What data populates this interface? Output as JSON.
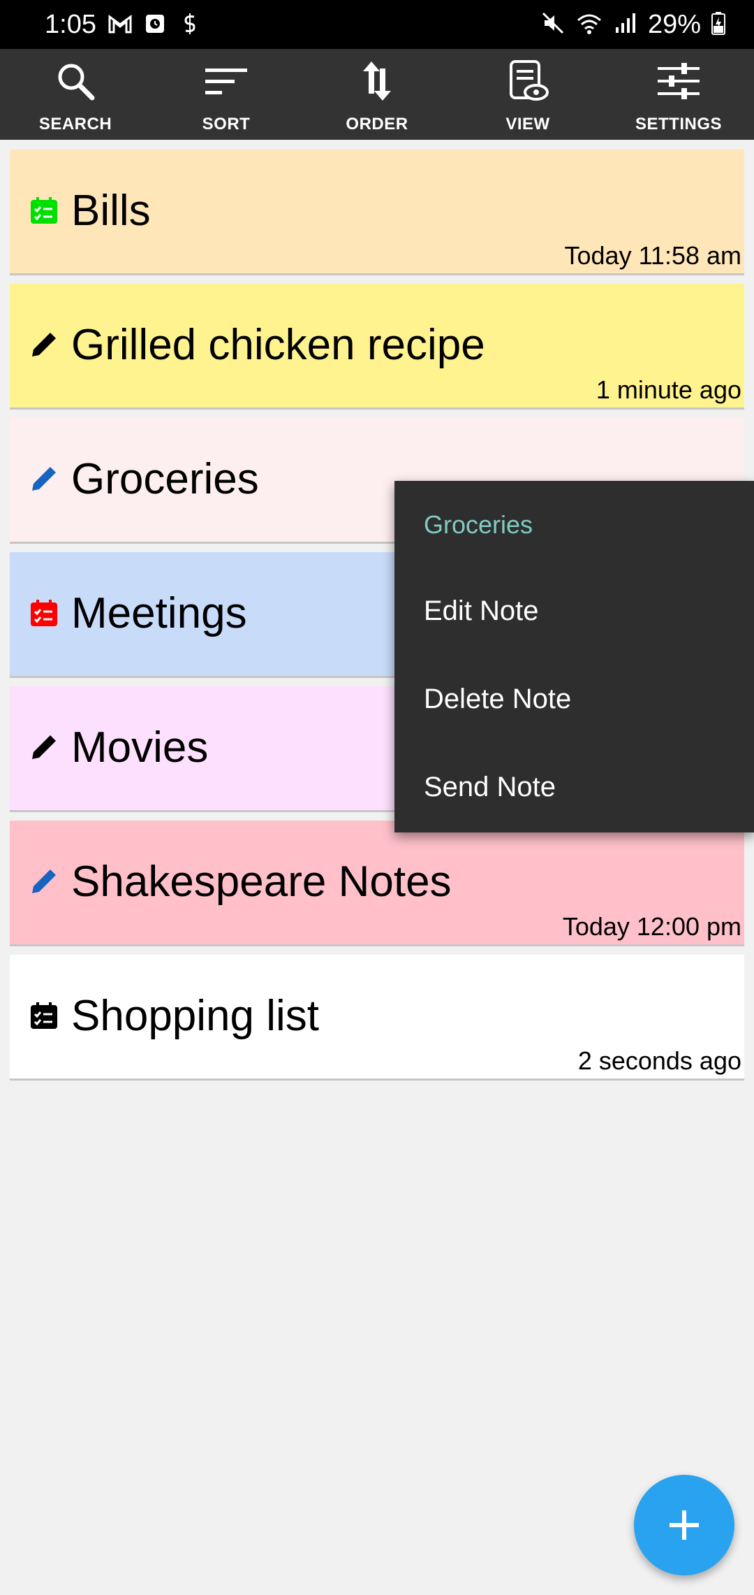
{
  "status_bar": {
    "time": "1:05",
    "battery": "29%"
  },
  "toolbar": {
    "items": [
      {
        "label": "SEARCH",
        "icon": "search-icon"
      },
      {
        "label": "SORT",
        "icon": "sort-icon"
      },
      {
        "label": "ORDER",
        "icon": "order-icon"
      },
      {
        "label": "VIEW",
        "icon": "view-icon"
      },
      {
        "label": "SETTINGS",
        "icon": "settings-icon"
      }
    ]
  },
  "notes": [
    {
      "title": "Bills",
      "time": "Today 11:58 am",
      "color": "#ffe6b8",
      "icon": "checklist-icon",
      "icon_color": "#00e000"
    },
    {
      "title": "Grilled chicken recipe",
      "time": "1 minute ago",
      "color": "#fff38f",
      "icon": "pencil-icon",
      "icon_color": "#000000"
    },
    {
      "title": "Groceries",
      "time": "",
      "color": "#fdeef0",
      "icon": "pencil-icon",
      "icon_color": "#1565c0"
    },
    {
      "title": "Meetings",
      "time": "",
      "color": "#c8dcfa",
      "icon": "checklist-icon",
      "icon_color": "#ff0000"
    },
    {
      "title": "Movies",
      "time": "",
      "color": "#fde0fd",
      "icon": "pencil-icon",
      "icon_color": "#000000"
    },
    {
      "title": "Shakespeare Notes",
      "time": "Today 12:00 pm",
      "color": "#ffc0ca",
      "icon": "pencil-icon",
      "icon_color": "#1565c0"
    },
    {
      "title": "Shopping list",
      "time": "2 seconds ago",
      "color": "#ffffff",
      "icon": "checklist-icon",
      "icon_color": "#000000"
    }
  ],
  "context_menu": {
    "header": "Groceries",
    "items": [
      "Edit Note",
      "Delete Note",
      "Send Note"
    ]
  },
  "fab": {
    "icon": "plus-icon",
    "color": "#29a3f0"
  }
}
